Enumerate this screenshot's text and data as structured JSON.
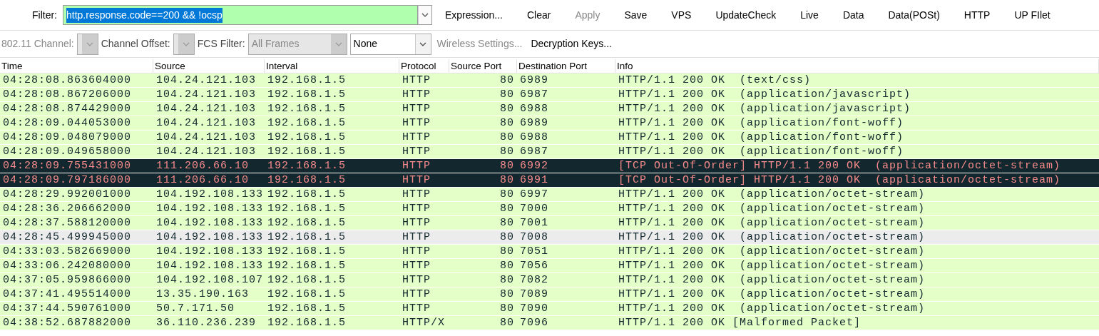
{
  "filter_bar": {
    "label": "Filter:",
    "value": "http.response.code==200 && !ocsp",
    "text_selected": true,
    "buttons": [
      {
        "label": "Expression...",
        "disabled": false
      },
      {
        "label": "Clear",
        "disabled": false
      },
      {
        "label": "Apply",
        "disabled": true
      },
      {
        "label": "Save",
        "disabled": false
      },
      {
        "label": "VPS",
        "disabled": false
      },
      {
        "label": "UpdateCheck",
        "disabled": false
      },
      {
        "label": "Live",
        "disabled": false
      },
      {
        "label": "Data",
        "disabled": false
      },
      {
        "label": "Data(POSt)",
        "disabled": false
      },
      {
        "label": "HTTP",
        "disabled": false
      },
      {
        "label": "UP FIlet",
        "disabled": false
      }
    ]
  },
  "wireless_bar": [
    {
      "kind": "label",
      "text": "802.11 Channel:",
      "disabled": true
    },
    {
      "kind": "combo",
      "disabled": true
    },
    {
      "kind": "label",
      "text": "Channel Offset:",
      "disabled": false
    },
    {
      "kind": "combo",
      "disabled": true
    },
    {
      "kind": "label",
      "text": "FCS Filter:",
      "disabled": false
    },
    {
      "kind": "combo",
      "value": "All Frames",
      "disabled": true
    },
    {
      "kind": "combo",
      "value": "None",
      "disabled": false
    },
    {
      "kind": "link",
      "text": "Wireless Settings...",
      "disabled": true
    },
    {
      "kind": "link",
      "text": "Decryption Keys...",
      "disabled": false
    }
  ],
  "table": {
    "columns": [
      "Time",
      "Source",
      "Interval",
      "Protocol",
      "Source Port",
      "Destination Port",
      "Info"
    ],
    "rows": [
      {
        "kind": "http",
        "cells": [
          "04:28:08.863604000",
          "104.24.121.103",
          "192.168.1.5",
          "HTTP",
          "80",
          "6989",
          "HTTP/1.1 200 OK  (text/css)"
        ]
      },
      {
        "kind": "http",
        "cells": [
          "04:28:08.867206000",
          "104.24.121.103",
          "192.168.1.5",
          "HTTP",
          "80",
          "6987",
          "HTTP/1.1 200 OK  (application/javascript)"
        ]
      },
      {
        "kind": "http",
        "cells": [
          "04:28:08.874429000",
          "104.24.121.103",
          "192.168.1.5",
          "HTTP",
          "80",
          "6988",
          "HTTP/1.1 200 OK  (application/javascript)"
        ]
      },
      {
        "kind": "http",
        "cells": [
          "04:28:09.044053000",
          "104.24.121.103",
          "192.168.1.5",
          "HTTP",
          "80",
          "6989",
          "HTTP/1.1 200 OK  (application/font-woff)"
        ]
      },
      {
        "kind": "http",
        "cells": [
          "04:28:09.048079000",
          "104.24.121.103",
          "192.168.1.5",
          "HTTP",
          "80",
          "6988",
          "HTTP/1.1 200 OK  (application/font-woff)"
        ]
      },
      {
        "kind": "http",
        "cells": [
          "04:28:09.049658000",
          "104.24.121.103",
          "192.168.1.5",
          "HTTP",
          "80",
          "6987",
          "HTTP/1.1 200 OK  (application/font-woff)"
        ]
      },
      {
        "kind": "bad_tcp",
        "cells": [
          "04:28:09.755431000",
          "111.206.66.10",
          "192.168.1.5",
          "HTTP",
          "80",
          "6992",
          "[TCP Out-Of-Order] HTTP/1.1 200 OK  (application/octet-stream)"
        ]
      },
      {
        "kind": "bad_tcp",
        "cells": [
          "04:28:09.797186000",
          "111.206.66.10",
          "192.168.1.5",
          "HTTP",
          "80",
          "6991",
          "[TCP Out-Of-Order] HTTP/1.1 200 OK  (application/octet-stream)"
        ]
      },
      {
        "kind": "http",
        "cells": [
          "04:28:29.992001000",
          "104.192.108.133",
          "192.168.1.5",
          "HTTP",
          "80",
          "6997",
          "HTTP/1.1 200 OK  (application/octet-stream)"
        ]
      },
      {
        "kind": "http",
        "cells": [
          "04:28:36.206662000",
          "104.192.108.133",
          "192.168.1.5",
          "HTTP",
          "80",
          "7000",
          "HTTP/1.1 200 OK  (application/octet-stream)"
        ]
      },
      {
        "kind": "http",
        "cells": [
          "04:28:37.588120000",
          "104.192.108.133",
          "192.168.1.5",
          "HTTP",
          "80",
          "7001",
          "HTTP/1.1 200 OK  (application/octet-stream)"
        ]
      },
      {
        "kind": "plain",
        "cells": [
          "04:28:45.499945000",
          "104.192.108.133",
          "192.168.1.5",
          "HTTP",
          "80",
          "7008",
          "HTTP/1.1 200 OK  (application/octet-stream)"
        ]
      },
      {
        "kind": "http",
        "cells": [
          "04:33:03.582669000",
          "104.192.108.133",
          "192.168.1.5",
          "HTTP",
          "80",
          "7051",
          "HTTP/1.1 200 OK  (application/octet-stream)"
        ]
      },
      {
        "kind": "http",
        "cells": [
          "04:33:06.242080000",
          "104.192.108.133",
          "192.168.1.5",
          "HTTP",
          "80",
          "7056",
          "HTTP/1.1 200 OK  (application/octet-stream)"
        ]
      },
      {
        "kind": "http",
        "cells": [
          "04:37:05.959866000",
          "104.192.108.107",
          "192.168.1.5",
          "HTTP",
          "80",
          "7082",
          "HTTP/1.1 200 OK  (application/octet-stream)"
        ]
      },
      {
        "kind": "http",
        "cells": [
          "04:37:41.495514000",
          "13.35.190.163",
          "192.168.1.5",
          "HTTP",
          "80",
          "7089",
          "HTTP/1.1 200 OK  (application/octet-stream)"
        ]
      },
      {
        "kind": "http",
        "cells": [
          "04:37:44.590761000",
          "50.7.171.50",
          "192.168.1.5",
          "HTTP",
          "80",
          "7090",
          "HTTP/1.1 200 OK  (application/octet-stream)"
        ]
      },
      {
        "kind": "http",
        "cells": [
          "04:38:52.687882000",
          "36.110.236.239",
          "192.168.1.5",
          "HTTP/X",
          "80",
          "7096",
          "HTTP/1.1 200 OK [Malformed Packet]"
        ]
      }
    ]
  }
}
